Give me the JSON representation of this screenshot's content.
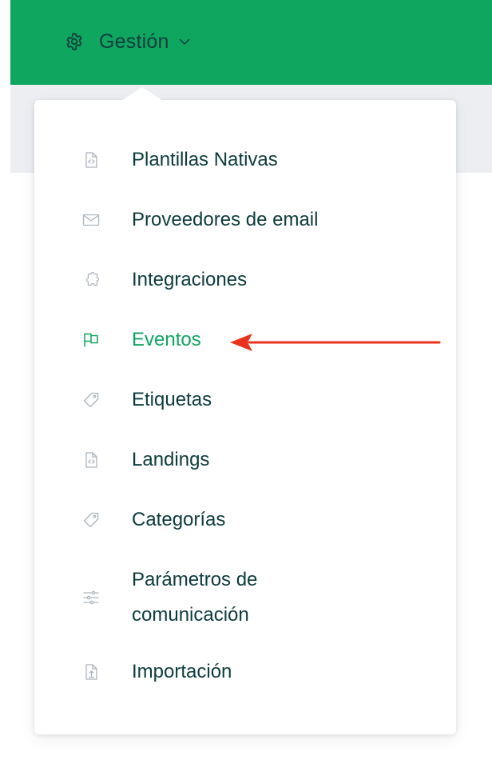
{
  "header": {
    "menu_label": "Gestión",
    "icon": "gear-icon",
    "background_color": "#0fa65f"
  },
  "dropdown": {
    "active_item": "Eventos",
    "items": [
      {
        "label": "Plantillas Nativas",
        "icon": "code-file-icon"
      },
      {
        "label": "Proveedores de email",
        "icon": "envelope-icon"
      },
      {
        "label": "Integraciones",
        "icon": "puzzle-icon"
      },
      {
        "label": "Eventos",
        "icon": "flag-icon"
      },
      {
        "label": "Etiquetas",
        "icon": "tag-icon"
      },
      {
        "label": "Landings",
        "icon": "code-file-icon"
      },
      {
        "label": "Categorías",
        "icon": "tag-icon"
      },
      {
        "label": "Parámetros de comunicación",
        "label_line1": "Parámetros de",
        "label_line2": "comunicación",
        "icon": "sliders-icon"
      },
      {
        "label": "Importación",
        "icon": "upload-file-icon"
      }
    ]
  },
  "colors": {
    "text": "#0d3b3c",
    "active": "#0fa65f",
    "icon": "#aab4bf",
    "annotation_arrow": "#e8321e"
  }
}
